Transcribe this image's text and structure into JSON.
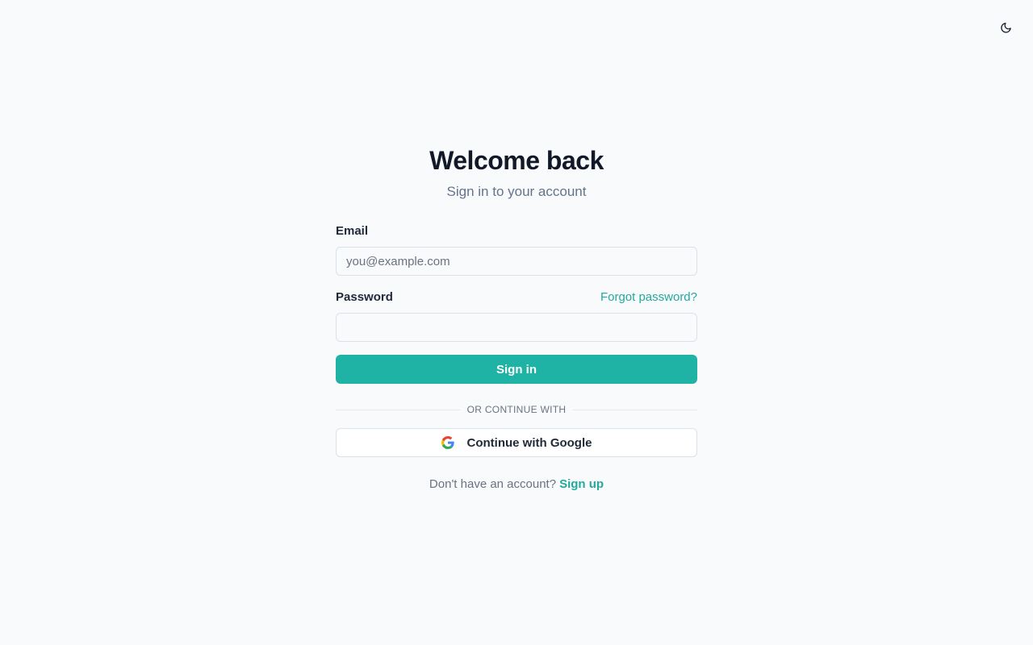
{
  "header": {
    "theme_toggle_icon": "moon-icon"
  },
  "card": {
    "title": "Welcome back",
    "subtitle": "Sign in to your account"
  },
  "form": {
    "email": {
      "label": "Email",
      "value": "",
      "placeholder": "you@example.com"
    },
    "password": {
      "label": "Password",
      "value": "",
      "placeholder": "",
      "forgot_label": "Forgot password?"
    },
    "submit_label": "Sign in"
  },
  "divider": {
    "text": "OR CONTINUE WITH"
  },
  "oauth": {
    "google_label": "Continue with Google",
    "google_icon": "google-icon"
  },
  "footer": {
    "prompt": "Don't have an account?",
    "signup_label": "Sign up"
  },
  "colors": {
    "background": "#f8fafc",
    "accent": "#1fb3a6",
    "link": "#23a99d",
    "text_primary": "#111827",
    "text_muted": "#64748b",
    "border": "#dbe1e8"
  }
}
